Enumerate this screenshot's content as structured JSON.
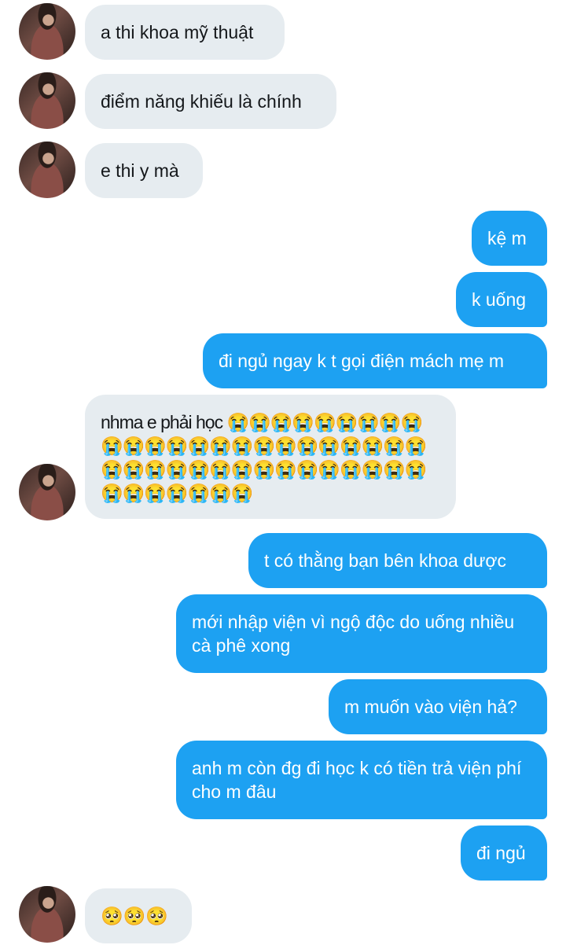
{
  "messages": [
    {
      "side": "in",
      "text": "a thi khoa mỹ thuật"
    },
    {
      "side": "in",
      "text": "điểm năng khiếu là chính"
    },
    {
      "side": "in",
      "text": "e thi y mà"
    },
    {
      "side": "out",
      "text": "kệ m"
    },
    {
      "side": "out",
      "text": "k uống"
    },
    {
      "side": "out",
      "text": "đi ngủ ngay k t gọi điện mách mẹ m"
    },
    {
      "side": "in",
      "text": "nhma e phải học 😭😭😭😭😭😭😭😭😭😭😭😭😭😭😭😭😭😭😭😭😭😭😭😭😭😭😭😭😭😭😭😭😭😭😭😭😭😭😭😭😭😭😭😭😭😭"
    },
    {
      "side": "out",
      "text": "t có thằng bạn bên khoa dược"
    },
    {
      "side": "out",
      "text": "mới nhập viện vì ngộ độc do uống nhiều cà phê xong"
    },
    {
      "side": "out",
      "text": "m muốn vào viện hả?"
    },
    {
      "side": "out",
      "text": "anh m còn đg đi học k có tiền trả viện phí cho m đâu"
    },
    {
      "side": "out",
      "text": "đi ngủ"
    },
    {
      "side": "in",
      "text": "🥺🥺🥺"
    }
  ]
}
